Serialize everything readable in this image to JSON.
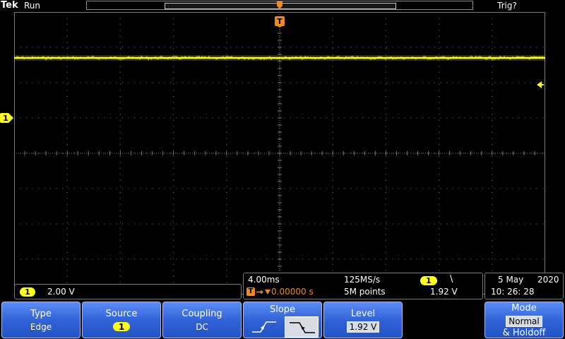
{
  "top_bar": {
    "brand": "Tek",
    "acquisition_state": "Run",
    "trigger_state": "Trig?"
  },
  "trigger_marker_label": "T",
  "channel1_marker_label": "1",
  "colors": {
    "channel1": "#ffff1e",
    "trigger": "#f08a1c",
    "menu_button": "#2f60d6",
    "graticule": "#7a7a7a"
  },
  "channel_readout": {
    "channel": "1",
    "scale": "2.00 V"
  },
  "horizontal_readout": {
    "time_per_div": "4.00ms",
    "sample_rate": "125MS/s",
    "trigger_source": "1",
    "trigger_slope_symbol": "\\",
    "trigger_position_label": "T",
    "trigger_position": "0.00000 s",
    "record_length": "5M points",
    "trigger_level": "1.92 V"
  },
  "date_time": {
    "date": "5 May",
    "year": "2020",
    "time": "10: 26: 28"
  },
  "menu": {
    "type": {
      "label": "Type",
      "value": "Edge"
    },
    "source": {
      "label": "Source",
      "value": "1"
    },
    "coupling": {
      "label": "Coupling",
      "value": "DC"
    },
    "slope": {
      "label": "Slope",
      "selected": "falling"
    },
    "level": {
      "label": "Level",
      "value": "1.92 V"
    },
    "mode": {
      "label": "Mode",
      "value": "Normal",
      "extra": "& Holdoff"
    }
  },
  "waveform": {
    "channel": "1",
    "form": "flat DC trace with noise",
    "level_divisions_above_center": 2.7
  }
}
